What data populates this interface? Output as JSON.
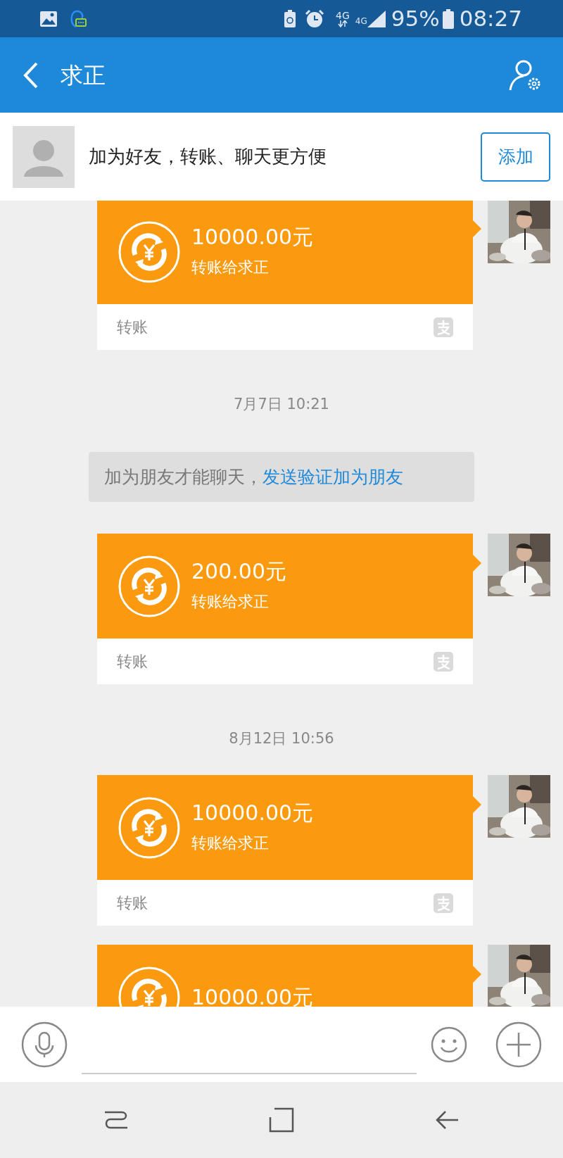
{
  "status_bar": {
    "network_label": "4G",
    "signal_label": "4G",
    "battery": "95%",
    "time": "08:27"
  },
  "header": {
    "title": "求正"
  },
  "friend_prompt": {
    "text": "加为好友，转账、聊天更方便",
    "button": "添加"
  },
  "messages": [
    {
      "kind": "transfer",
      "amount": "10000.00元",
      "subtitle": "转账给求正",
      "footer": "转账"
    },
    {
      "kind": "time",
      "text": "7月7日 10:21"
    },
    {
      "kind": "notice",
      "text": "加为朋友才能聊天，",
      "link": "发送验证加为朋友"
    },
    {
      "kind": "transfer",
      "amount": "200.00元",
      "subtitle": "转账给求正",
      "footer": "转账"
    },
    {
      "kind": "time",
      "text": "8月12日 10:56"
    },
    {
      "kind": "transfer",
      "amount": "10000.00元",
      "subtitle": "转账给求正",
      "footer": "转账"
    },
    {
      "kind": "transfer",
      "amount": "10000.00元"
    }
  ]
}
